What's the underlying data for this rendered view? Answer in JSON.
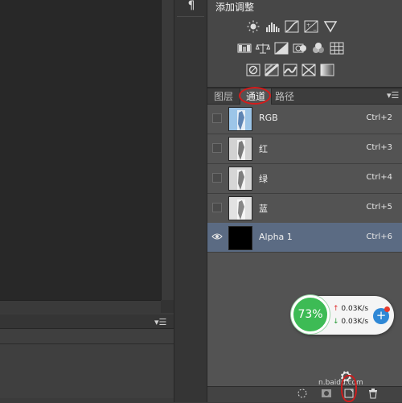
{
  "dock": {
    "paragraph_icon": "¶"
  },
  "adjustments": {
    "title": "添加调整",
    "icons_row1": [
      "brightness-contrast-icon",
      "levels-icon",
      "curves-icon",
      "exposure-icon",
      "vibrance-icon"
    ],
    "icons_row2": [
      "hue-saturation-icon",
      "color-balance-icon",
      "black-white-icon",
      "photo-filter-icon",
      "channel-mixer-icon",
      "color-lookup-icon"
    ],
    "icons_row3": [
      "invert-icon",
      "posterize-icon",
      "threshold-icon",
      "selective-color-icon",
      "gradient-map-icon"
    ]
  },
  "tabs": [
    {
      "label": "图层"
    },
    {
      "label": "通道"
    },
    {
      "label": "路径"
    }
  ],
  "channels": [
    {
      "name": "RGB",
      "shortcut": "Ctrl+2"
    },
    {
      "name": "红",
      "shortcut": "Ctrl+3"
    },
    {
      "name": "绿",
      "shortcut": "Ctrl+4"
    },
    {
      "name": "蓝",
      "shortcut": "Ctrl+5"
    },
    {
      "name": "Alpha 1",
      "shortcut": "Ctrl+6"
    }
  ],
  "speed": {
    "percent": "73%",
    "up": "0.03K/s",
    "down": "0.03K/s"
  },
  "watermark": {
    "text": "n.baidu.com"
  },
  "colors": {
    "selected_row": "#5b6b83",
    "annotation_red": "#d61b1b",
    "speed_green": "#3dbb55"
  }
}
